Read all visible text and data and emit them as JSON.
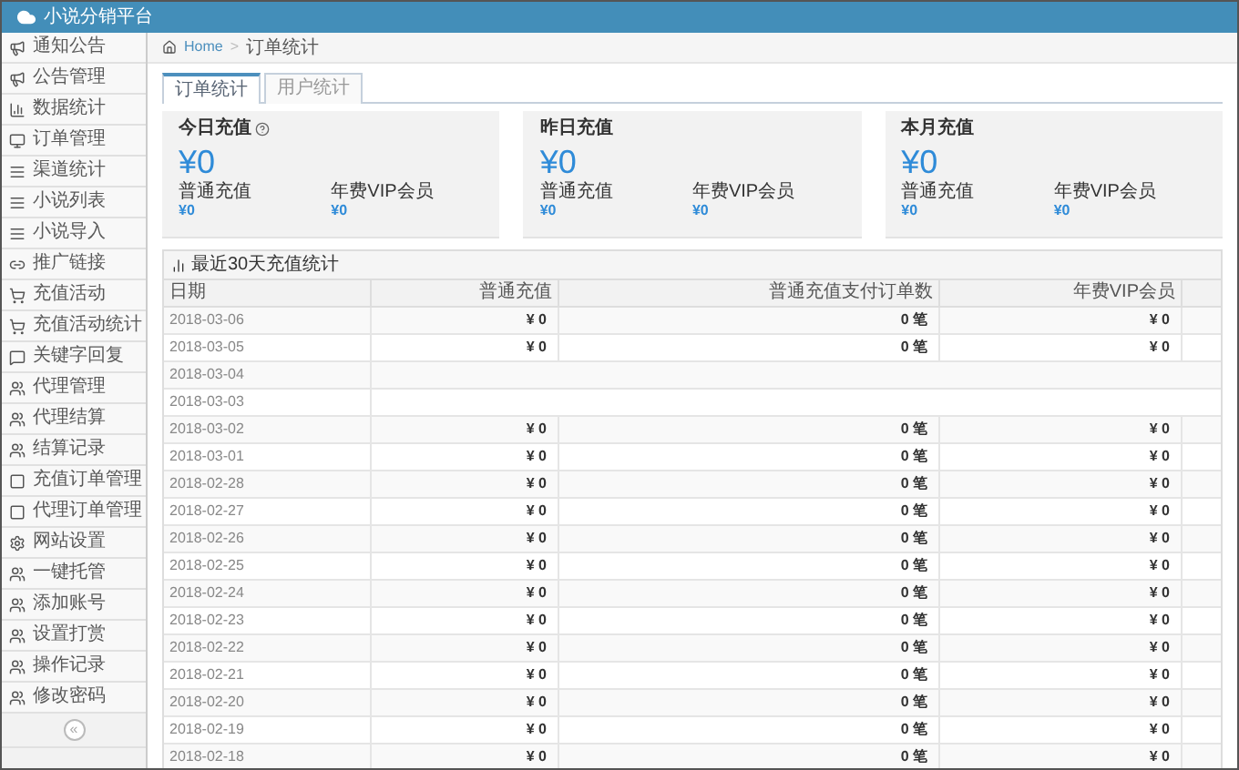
{
  "app": {
    "title": "小说分销平台"
  },
  "sidebar": {
    "items": [
      {
        "label": "通知公告",
        "selected": false
      },
      {
        "label": "公告管理",
        "selected": false
      },
      {
        "label": "数据统计",
        "selected": false
      },
      {
        "label": "订单管理",
        "selected": false
      },
      {
        "label": "渠道统计",
        "selected": false
      },
      {
        "label": "小说列表",
        "selected": false
      },
      {
        "label": "小说导入",
        "selected": false
      },
      {
        "label": "推广链接",
        "selected": false
      },
      {
        "label": "充值活动",
        "selected": false
      },
      {
        "label": "充值活动统计",
        "selected": false
      },
      {
        "label": "关键字回复",
        "selected": false
      },
      {
        "label": "代理管理",
        "selected": false
      },
      {
        "label": "代理结算",
        "selected": false
      },
      {
        "label": "结算记录",
        "selected": false
      },
      {
        "label": "充值订单管理",
        "selected": false
      },
      {
        "label": "代理订单管理",
        "selected": false
      },
      {
        "label": "网站设置",
        "selected": false
      },
      {
        "label": "一键托管",
        "selected": false
      },
      {
        "label": "添加账号",
        "selected": false
      },
      {
        "label": "设置打赏",
        "selected": false
      },
      {
        "label": "操作记录",
        "selected": false
      },
      {
        "label": "修改密码",
        "selected": false
      }
    ],
    "collapse": "«"
  },
  "breadcrumb": {
    "items": [
      "Home",
      "订单统计"
    ],
    "separator": ">"
  },
  "tabs": [
    {
      "label": "订单统计",
      "selected": true
    },
    {
      "label": "用户统计",
      "selected": false
    }
  ],
  "cards": [
    {
      "title": "今日充值",
      "help": true,
      "amount": "¥0",
      "stats": [
        {
          "label": "普通充值",
          "value": "¥0"
        },
        {
          "label": "年费VIP会员",
          "value": "¥0"
        }
      ]
    },
    {
      "title": "昨日充值",
      "help": false,
      "amount": "¥0",
      "stats": [
        {
          "label": "普通充值",
          "value": "¥0"
        },
        {
          "label": "年费VIP会员",
          "value": "¥0"
        }
      ]
    },
    {
      "title": "本月充值",
      "help": false,
      "amount": "¥0",
      "stats": [
        {
          "label": "普通充值",
          "value": "¥0"
        },
        {
          "label": "年费VIP会员",
          "value": "¥0"
        }
      ]
    }
  ],
  "table": {
    "title": "最近30天充值统计",
    "columns": [
      "日期",
      "普通充值",
      "普通充值支付订单数",
      "年费VIP会员"
    ],
    "rows": [
      {
        "date": "2018-03-06",
        "normal": "¥ 0",
        "orders": "0 笔",
        "vip": "¥ 0"
      },
      {
        "date": "2018-03-05",
        "normal": "¥ 0",
        "orders": "0 笔",
        "vip": "¥ 0"
      },
      {
        "date": "2018-03-04"
      },
      {
        "date": "2018-03-03"
      },
      {
        "date": "2018-03-02",
        "normal": "¥ 0",
        "orders": "0 笔",
        "vip": "¥ 0"
      },
      {
        "date": "2018-03-01",
        "normal": "¥ 0",
        "orders": "0 笔",
        "vip": "¥ 0"
      },
      {
        "date": "2018-02-28",
        "normal": "¥ 0",
        "orders": "0 笔",
        "vip": "¥ 0"
      },
      {
        "date": "2018-02-27",
        "normal": "¥ 0",
        "orders": "0 笔",
        "vip": "¥ 0"
      },
      {
        "date": "2018-02-26",
        "normal": "¥ 0",
        "orders": "0 笔",
        "vip": "¥ 0"
      },
      {
        "date": "2018-02-25",
        "normal": "¥ 0",
        "orders": "0 笔",
        "vip": "¥ 0"
      },
      {
        "date": "2018-02-24",
        "normal": "¥ 0",
        "orders": "0 笔",
        "vip": "¥ 0"
      },
      {
        "date": "2018-02-23",
        "normal": "¥ 0",
        "orders": "0 笔",
        "vip": "¥ 0"
      },
      {
        "date": "2018-02-22",
        "normal": "¥ 0",
        "orders": "0 笔",
        "vip": "¥ 0"
      },
      {
        "date": "2018-02-21",
        "normal": "¥ 0",
        "orders": "0 笔",
        "vip": "¥ 0"
      },
      {
        "date": "2018-02-20",
        "normal": "¥ 0",
        "orders": "0 笔",
        "vip": "¥ 0"
      },
      {
        "date": "2018-02-19",
        "normal": "¥ 0",
        "orders": "0 笔",
        "vip": "¥ 0"
      },
      {
        "date": "2018-02-18",
        "normal": "¥ 0",
        "orders": "0 笔",
        "vip": "¥ 0"
      }
    ]
  }
}
